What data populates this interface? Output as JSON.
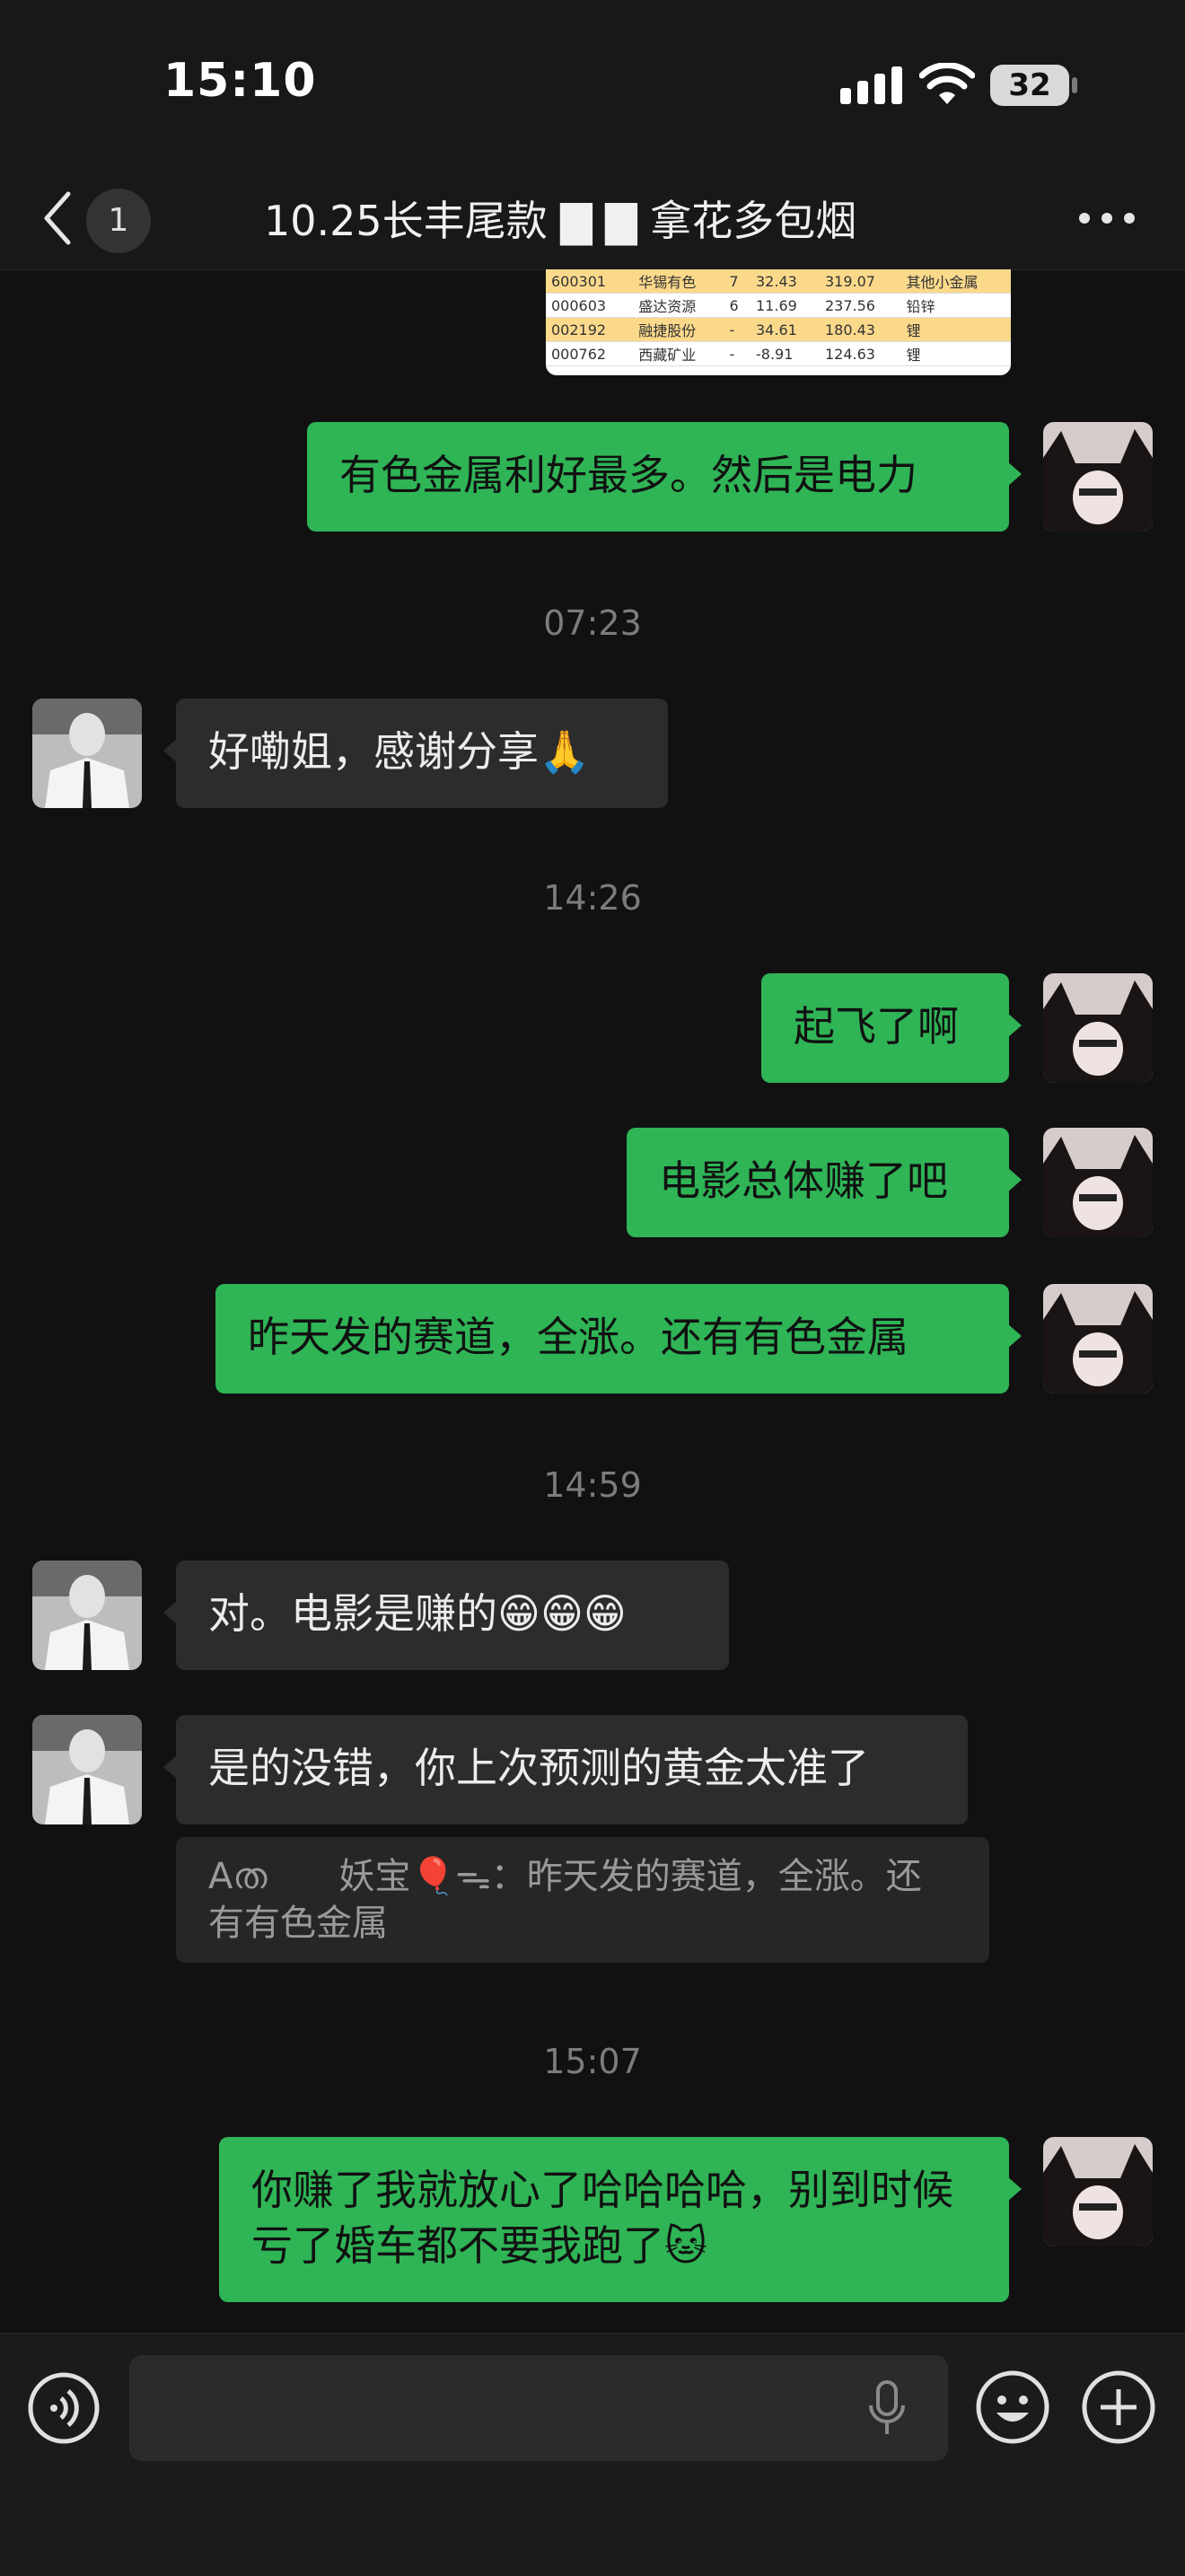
{
  "status": {
    "time": "15:10",
    "battery": "32"
  },
  "header": {
    "badge": "1",
    "title": "10.25长丰尾款 ▇ ▇ 拿花多包烟"
  },
  "table": {
    "rows": [
      [
        "600301",
        "华锡有色",
        "7",
        "32.43",
        "319.07",
        "其他小金属"
      ],
      [
        "000603",
        "盛达资源",
        "6",
        "11.69",
        "237.56",
        "铅锌"
      ],
      [
        "002192",
        "融捷股份",
        "-",
        "34.61",
        "180.43",
        "锂"
      ],
      [
        "000762",
        "西藏矿业",
        "-",
        "-8.91",
        "124.63",
        "锂"
      ]
    ]
  },
  "messages": {
    "m1": "有色金属利好最多。然后是电力",
    "t1": "07:23",
    "m2": "好嘞姐，感谢分享🙏",
    "t2": "14:26",
    "m3": "起飞了啊",
    "m4": "电影总体赚了吧",
    "m5": "昨天发的赛道，全涨。还有有色金属",
    "t3": "14:59",
    "m6": "对。电影是赚的😁😁😁",
    "m7": "是的没错，你上次预测的黄金太准了",
    "quote": "Aത　　妖宝🎈ᯓ：昨天发的赛道，全涨。还有有色金属",
    "t4": "15:07",
    "m8": "你赚了我就放心了哈哈哈哈，别到时候亏了婚车都不要我跑了🐱"
  },
  "colors": {
    "me_bubble": "#2fb456",
    "other_bubble": "#2c2c2c",
    "background": "#111111"
  },
  "icons": [
    "back-icon",
    "more-icon",
    "voice-icon",
    "mic-icon",
    "emoji-icon",
    "plus-icon",
    "signal-icon",
    "wifi-icon"
  ]
}
